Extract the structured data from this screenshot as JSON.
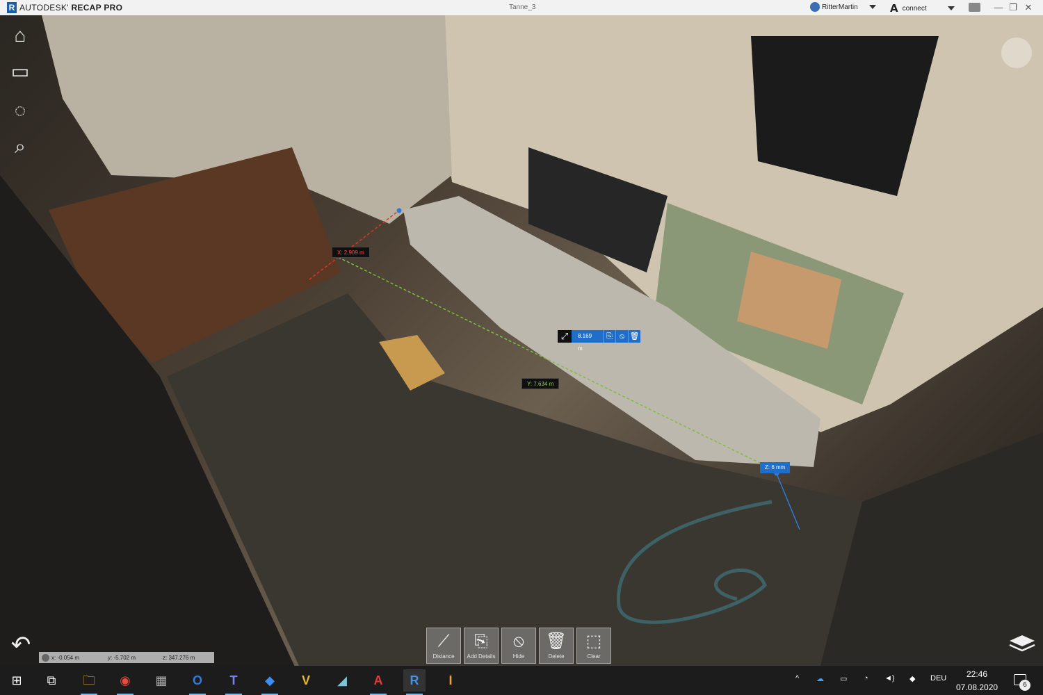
{
  "titlebar": {
    "brand_logo": "R",
    "brand_name": "AUTODESK",
    "product_name": "RECAP PRO",
    "document": "Tanne_3",
    "user": "RitterMartin",
    "connect_label": "connect",
    "connect_logo": "A"
  },
  "window_controls": {
    "minimize": "—",
    "restore": "❐",
    "close": "✕"
  },
  "left_tools": {
    "home": "⌂",
    "views": "▭",
    "orbit": "◌",
    "zoom": "⌕",
    "back": "↶"
  },
  "coords": {
    "x": "x:  -0.054   m",
    "y": "y:  -5.702   m",
    "z": "z:  347.276   m"
  },
  "measurements": {
    "x_label": "X:  2.909 m",
    "y_label": "Y:  7.634 m",
    "z_label": "Z:  6 mm",
    "distance_value": "8.169 m",
    "expand_icon": "⤢",
    "actions": [
      "⎘",
      "⦸",
      "🗑"
    ]
  },
  "toolbar": {
    "buttons": [
      {
        "label": "Distance",
        "icon": "⟋"
      },
      {
        "label": "Add Details",
        "icon": "⎘"
      },
      {
        "label": "Hide",
        "icon": "⦸"
      },
      {
        "label": "Delete",
        "icon": "🗑"
      },
      {
        "label": "Clear",
        "icon": "⬚"
      }
    ]
  },
  "taskbar": {
    "start": "⊞",
    "task_view": "⧉",
    "apps": [
      "File Explorer",
      "Chrome",
      "Calculator",
      "Outlook",
      "Teams",
      "Dropbox",
      "Vault",
      "Sketch",
      "AutoCAD",
      "ReCap",
      "Inventor"
    ],
    "app_glyphs": [
      "🗀",
      "◉",
      "▦",
      "O",
      "T",
      "◆",
      "V",
      "◢",
      "A",
      "R",
      "I"
    ],
    "language": "DEU",
    "time": "22:46",
    "date": "07.08.2020",
    "notifications": "6",
    "tray_icons": [
      "^",
      "☁",
      "▭",
      "◔",
      "◄)",
      "◆"
    ]
  },
  "colors": {
    "accent": "#1f6ec9",
    "title_bg": "#f2f2f2",
    "taskbar": "#1c1c1c"
  }
}
